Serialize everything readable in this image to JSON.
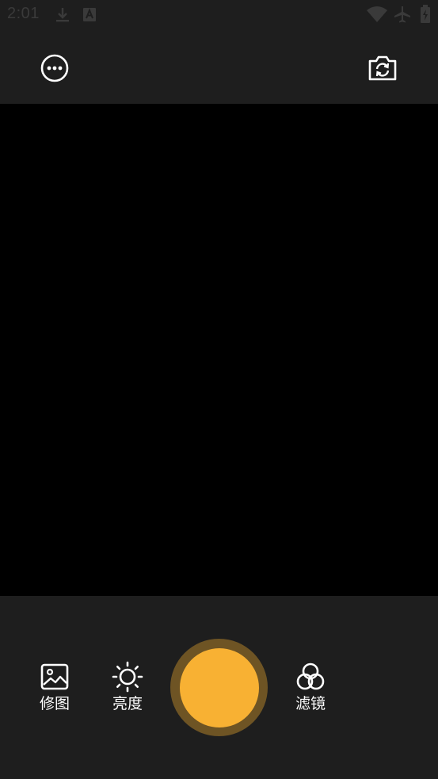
{
  "status_bar": {
    "time": "2:01",
    "icons": [
      "download-icon",
      "notification-a-icon",
      "wifi-icon",
      "airplane-icon",
      "battery-icon"
    ]
  },
  "top_bar": {
    "more_icon": "more-options-icon",
    "switch_camera_icon": "switch-camera-icon"
  },
  "tools": [
    {
      "label": "修图",
      "icon": "image-edit-icon"
    },
    {
      "label": "亮度",
      "icon": "brightness-icon"
    },
    {
      "label": "滤镜",
      "icon": "filter-icon"
    }
  ],
  "shutter": {
    "icon": "shutter-button"
  },
  "colors": {
    "background": "#1e1e1e",
    "viewfinder": "#000000",
    "shutter_outer": "#6e5424",
    "shutter_inner": "#f8b133",
    "status_text": "#3a3a3a",
    "icon": "#ffffff"
  }
}
